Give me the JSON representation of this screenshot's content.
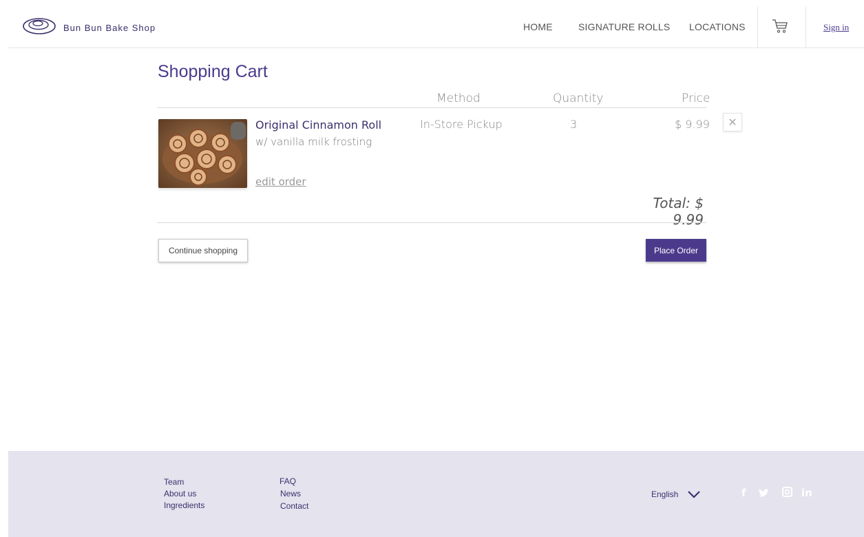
{
  "header": {
    "brand": "Bun Bun Bake Shop",
    "nav": [
      "HOME",
      "SIGNATURE ROLLS",
      "LOCATIONS"
    ],
    "cart_icon": "cart-icon",
    "signin": "Sign in"
  },
  "cart": {
    "title": "Shopping Cart",
    "columns": {
      "method": "Method",
      "quantity": "Quantity",
      "price": "Price"
    },
    "item": {
      "name": "Original Cinnamon Roll",
      "subtitle": "w/ vanilla milk frosting",
      "edit": "edit order",
      "method": "In-Store Pickup",
      "quantity": "3",
      "price": "$ 9.99",
      "remove_icon": "close-icon"
    },
    "total_label": "Total:",
    "total_value": "$ 9.99",
    "continue_label": "Continue shopping",
    "order_label": "Place Order"
  },
  "footer": {
    "col1": [
      "Team",
      "About us",
      "Ingredients"
    ],
    "col2": [
      "FAQ",
      "News",
      "Contact"
    ],
    "language": "English",
    "social": [
      "facebook-icon",
      "twitter-icon",
      "instagram-icon",
      "linkedin-icon"
    ]
  },
  "colors": {
    "accent": "#4b3a8c",
    "footer_bg": "#e4e3ee"
  }
}
